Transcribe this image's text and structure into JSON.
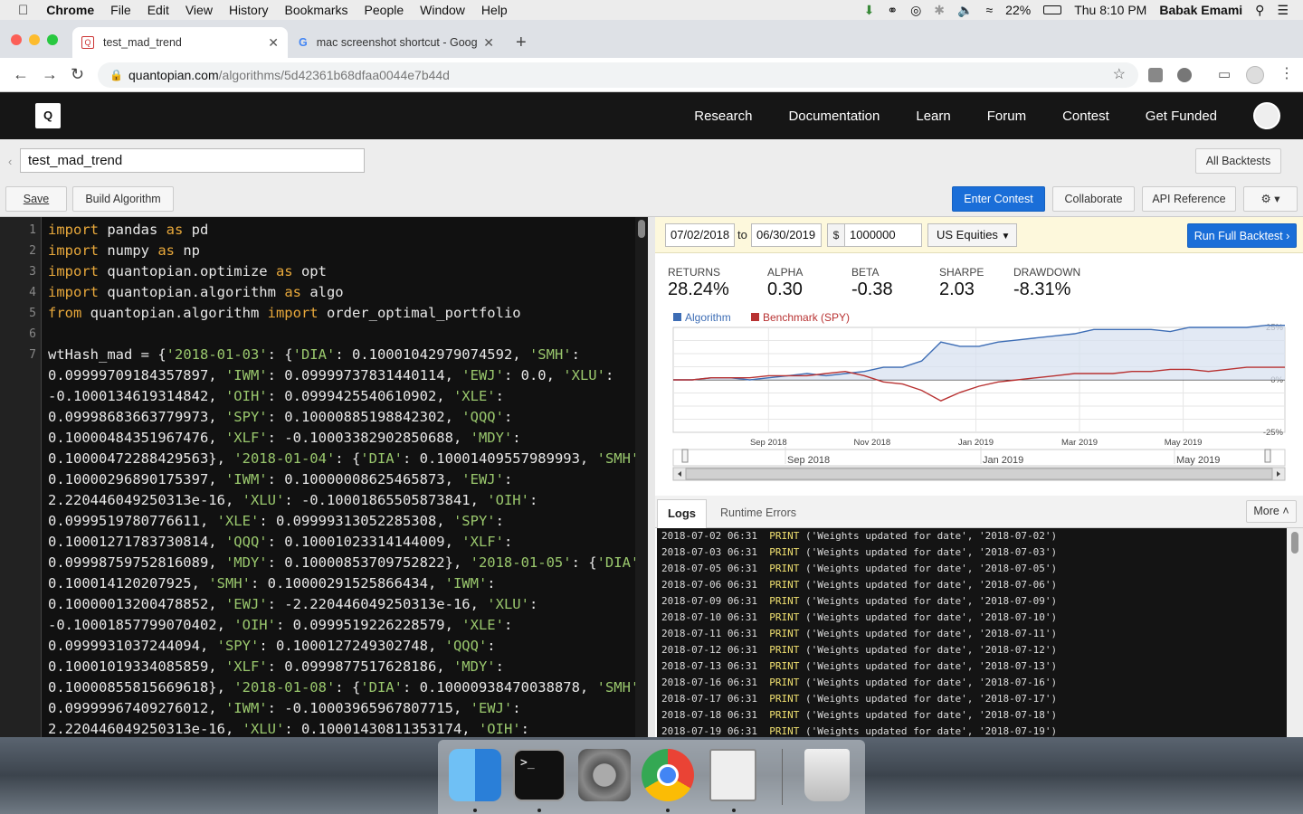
{
  "menubar": {
    "items": [
      "Chrome",
      "File",
      "Edit",
      "View",
      "History",
      "Bookmarks",
      "People",
      "Window",
      "Help"
    ],
    "battery": "22%",
    "clock": "Thu 8:10 PM",
    "user": "Babak Emami"
  },
  "browser": {
    "tabs": [
      {
        "title": "test_mad_trend",
        "active": true
      },
      {
        "title": "mac screenshot shortcut - Goog",
        "active": false
      }
    ],
    "url_domain": "quantopian.com",
    "url_path": "/algorithms/5d42361b68dfaa0044e7b44d"
  },
  "site": {
    "logo": "Q",
    "nav": [
      "Research",
      "Documentation",
      "Learn",
      "Forum",
      "Contest",
      "Get Funded"
    ]
  },
  "ide": {
    "algo_name": "test_mad_trend",
    "all_backtests": "All Backtests",
    "save": "Save",
    "build": "Build Algorithm",
    "enter_contest": "Enter Contest",
    "collaborate": "Collaborate",
    "api_reference": "API Reference"
  },
  "code": {
    "line_numbers": [
      "1",
      "2",
      "3",
      "4",
      "5",
      "6",
      "7"
    ],
    "lines": [
      "import pandas as pd",
      "import numpy as np",
      "import quantopian.optimize as opt",
      "import quantopian.algorithm as algo",
      "from quantopian.algorithm import order_optimal_portfolio",
      "",
      "wtHash_mad = {'2018-01-03': {'DIA': 0.10001042979074592, 'SMH':",
      "0.09999709184357897, 'IWM': 0.09999737831440114, 'EWJ': 0.0, 'XLU':",
      "-0.1000134619314842, 'OIH': 0.0999425540610902, 'XLE':",
      "0.09998683663779973, 'SPY': 0.10000885198842302, 'QQQ':",
      "0.10000484351967476, 'XLF': -0.10003382902850688, 'MDY':",
      "0.10000472288429563}, '2018-01-04': {'DIA': 0.10001409557989993, 'SMH':",
      "0.10000296890175397, 'IWM': 0.10000008625465873, 'EWJ':",
      "2.220446049250313e-16, 'XLU': -0.10001865505873841, 'OIH':",
      "0.0999519780776611, 'XLE': 0.09999313052285308, 'SPY':",
      "0.10001271783730814, 'QQQ': 0.10001023314144009, 'XLF':",
      "0.09998759752816089, 'MDY': 0.10000853709752822}, '2018-01-05': {'DIA':",
      "0.100014120207925, 'SMH': 0.10000291525866434, 'IWM':",
      "0.10000013200478852, 'EWJ': -2.220446049250313e-16, 'XLU':",
      "-0.10001857799070402, 'OIH': 0.0999519226228579, 'XLE':",
      "0.0999931037244094, 'SPY': 0.1000127249302748, 'QQQ':",
      "0.10001019334085859, 'XLF': 0.0999877517628186, 'MDY':",
      "0.10000855815669618}, '2018-01-08': {'DIA': 0.10000938470038878, 'SMH':",
      "0.09999967409276012, 'IWM': -0.10003965967807715, 'EWJ':",
      "2.220446049250313e-16, 'XLU': 0.10001430811353174, 'OIH':"
    ]
  },
  "backtest": {
    "start_date": "07/02/2018",
    "to": "to",
    "end_date": "06/30/2019",
    "currency": "$",
    "capital": "1000000",
    "universe": "US Equities",
    "run": "Run Full Backtest",
    "metrics": [
      {
        "label": "RETURNS",
        "value": "28.24%"
      },
      {
        "label": "ALPHA",
        "value": "0.30"
      },
      {
        "label": "BETA",
        "value": "-0.38"
      },
      {
        "label": "SHARPE",
        "value": "2.03"
      },
      {
        "label": "DRAWDOWN",
        "value": "-8.31%"
      }
    ]
  },
  "chart_data": {
    "type": "line",
    "series": [
      {
        "name": "Algorithm",
        "color": "#3d6db5",
        "values": [
          0,
          0,
          1,
          1,
          0,
          1,
          2,
          3,
          2,
          3,
          4,
          6,
          6,
          9,
          18,
          16,
          16,
          18,
          19,
          20,
          21,
          22,
          24,
          24,
          24,
          24,
          23,
          25,
          25,
          25,
          25,
          26,
          26
        ]
      },
      {
        "name": "Benchmark (SPY)",
        "color": "#b83232",
        "values": [
          0,
          0,
          1,
          1,
          1,
          2,
          2,
          2,
          3,
          4,
          2,
          -1,
          -2,
          -5,
          -10,
          -6,
          -3,
          -1,
          0,
          1,
          2,
          3,
          3,
          3,
          4,
          4,
          5,
          5,
          4,
          5,
          6,
          6,
          6
        ]
      }
    ],
    "y_tick_labels": [
      "25%",
      "0%",
      "-25%"
    ],
    "ylim": [
      -25,
      25
    ],
    "x_tick_labels": [
      "Sep 2018",
      "Nov 2018",
      "Jan 2019",
      "Mar 2019",
      "May 2019"
    ],
    "navigator_labels": [
      "Sep 2018",
      "Jan 2019",
      "May 2019"
    ],
    "grid": true,
    "legend_position": "top-left"
  },
  "logs": {
    "tab_logs": "Logs",
    "tab_errors": "Runtime Errors",
    "more": "More",
    "lines": [
      {
        "ts": "2018-07-02 06:31",
        "level": "PRINT",
        "msg": "('Weights updated for date', '2018-07-02')"
      },
      {
        "ts": "2018-07-03 06:31",
        "level": "PRINT",
        "msg": "('Weights updated for date', '2018-07-03')"
      },
      {
        "ts": "2018-07-05 06:31",
        "level": "PRINT",
        "msg": "('Weights updated for date', '2018-07-05')"
      },
      {
        "ts": "2018-07-06 06:31",
        "level": "PRINT",
        "msg": "('Weights updated for date', '2018-07-06')"
      },
      {
        "ts": "2018-07-09 06:31",
        "level": "PRINT",
        "msg": "('Weights updated for date', '2018-07-09')"
      },
      {
        "ts": "2018-07-10 06:31",
        "level": "PRINT",
        "msg": "('Weights updated for date', '2018-07-10')"
      },
      {
        "ts": "2018-07-11 06:31",
        "level": "PRINT",
        "msg": "('Weights updated for date', '2018-07-11')"
      },
      {
        "ts": "2018-07-12 06:31",
        "level": "PRINT",
        "msg": "('Weights updated for date', '2018-07-12')"
      },
      {
        "ts": "2018-07-13 06:31",
        "level": "PRINT",
        "msg": "('Weights updated for date', '2018-07-13')"
      },
      {
        "ts": "2018-07-16 06:31",
        "level": "PRINT",
        "msg": "('Weights updated for date', '2018-07-16')"
      },
      {
        "ts": "2018-07-17 06:31",
        "level": "PRINT",
        "msg": "('Weights updated for date', '2018-07-17')"
      },
      {
        "ts": "2018-07-18 06:31",
        "level": "PRINT",
        "msg": "('Weights updated for date', '2018-07-18')"
      },
      {
        "ts": "2018-07-19 06:31",
        "level": "PRINT",
        "msg": "('Weights updated for date', '2018-07-19')"
      }
    ]
  },
  "dock": {
    "apps": [
      "finder-icon",
      "terminal-icon",
      "system-preferences-icon",
      "chrome-icon",
      "preview-icon",
      "trash-icon"
    ],
    "terminal_glyph": ">_"
  }
}
